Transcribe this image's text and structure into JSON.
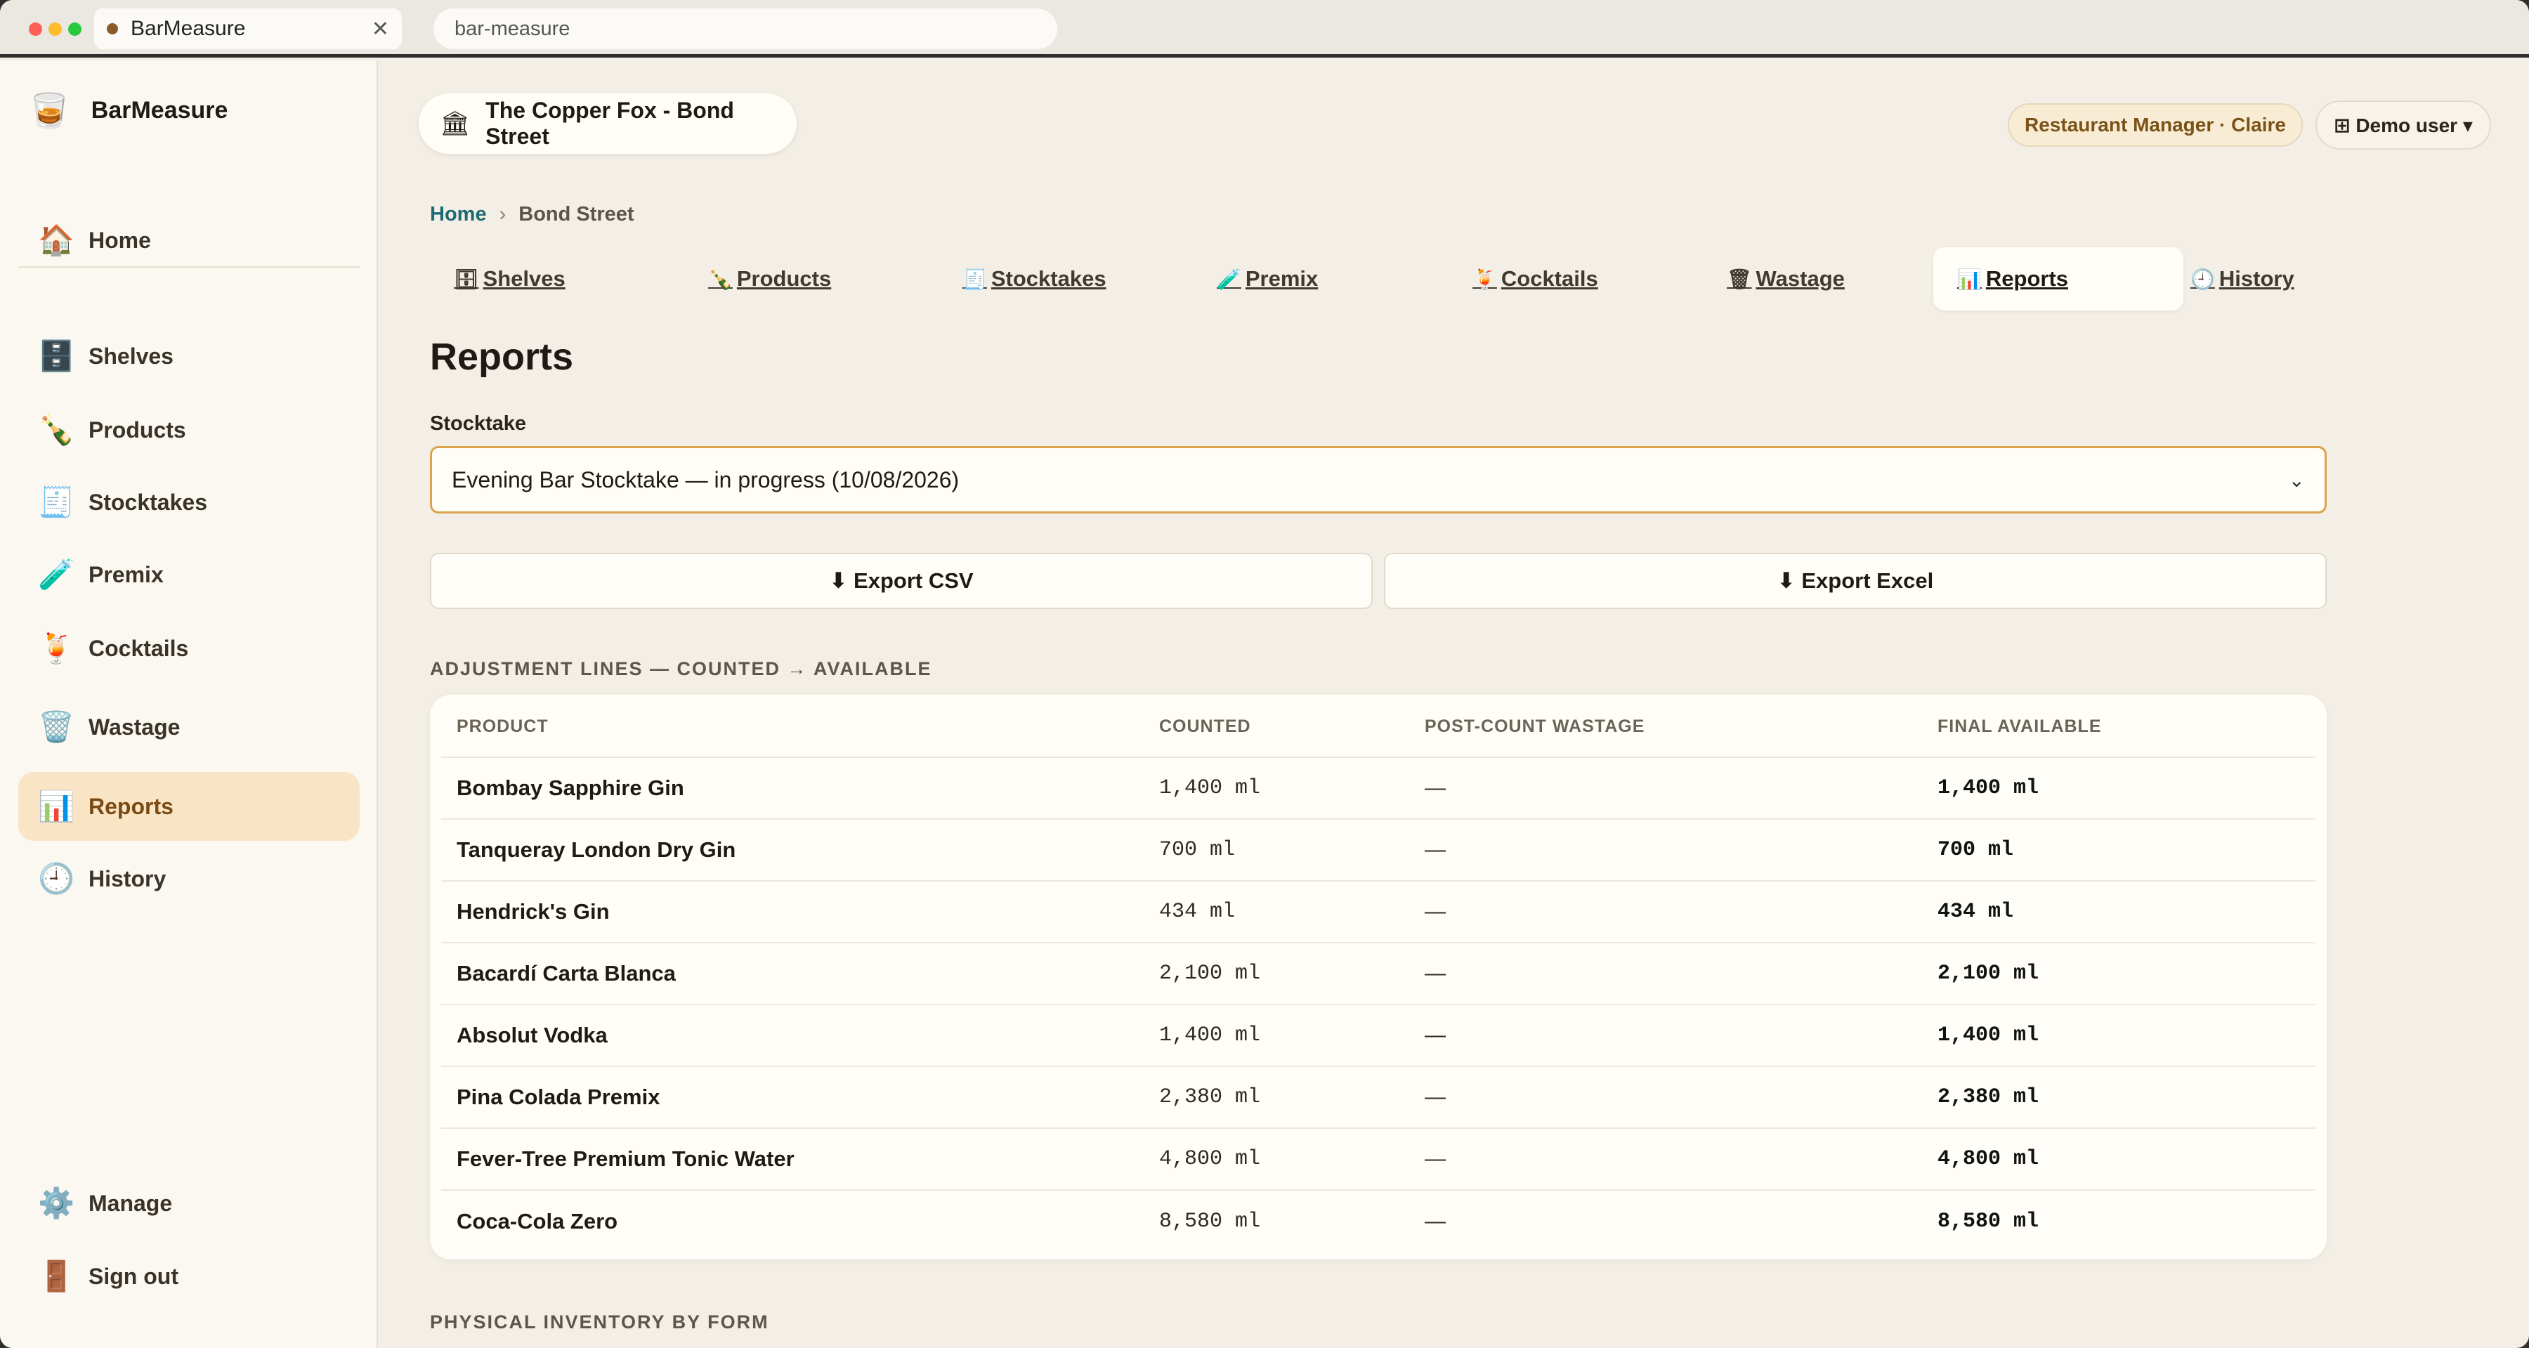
{
  "browser": {
    "tab_title": "BarMeasure",
    "url": "bar-measure"
  },
  "sidebar": {
    "brand": "BarMeasure",
    "items": [
      {
        "label": "Home",
        "icon": "house-icon",
        "glyph": "🏠"
      },
      {
        "label": "Shelves",
        "icon": "cabinet-icon",
        "glyph": "🗄️"
      },
      {
        "label": "Products",
        "icon": "bottle-icon",
        "glyph": "🍾"
      },
      {
        "label": "Stocktakes",
        "icon": "receipt-icon",
        "glyph": "🧾"
      },
      {
        "label": "Premix",
        "icon": "test-tube-icon",
        "glyph": "🧪"
      },
      {
        "label": "Cocktails",
        "icon": "cocktail-icon",
        "glyph": "🍹"
      },
      {
        "label": "Wastage",
        "icon": "wastebasket-icon",
        "glyph": "🗑️"
      },
      {
        "label": "Reports",
        "icon": "bar-chart-icon",
        "glyph": "📊"
      },
      {
        "label": "History",
        "icon": "clock-icon",
        "glyph": "🕘"
      },
      {
        "label": "Manage",
        "icon": "gear-icon",
        "glyph": "⚙️"
      },
      {
        "label": "Sign out",
        "icon": "door-icon",
        "glyph": "🚪"
      }
    ]
  },
  "header": {
    "venue": "The Copper Fox - Bond Street",
    "role": "Restaurant Manager · Claire",
    "user_menu": "⊞ Demo user ▾"
  },
  "breadcrumb": {
    "home": "Home",
    "current": "Bond Street"
  },
  "subnav": [
    {
      "label": "Shelves",
      "glyph": "🗄"
    },
    {
      "label": "Products",
      "glyph": "🍾"
    },
    {
      "label": "Stocktakes",
      "glyph": "🧾"
    },
    {
      "label": "Premix",
      "glyph": "🧪"
    },
    {
      "label": "Cocktails",
      "glyph": "🍹"
    },
    {
      "label": "Wastage",
      "glyph": "🗑"
    },
    {
      "label": "Reports",
      "glyph": "📊"
    },
    {
      "label": "History",
      "glyph": "🕘"
    }
  ],
  "page": {
    "title": "Reports",
    "stocktake_label": "Stocktake",
    "stocktake_value": "Evening Bar Stocktake — in progress (10/08/2026)",
    "export_csv": "⬇ Export CSV",
    "export_excel": "⬇ Export Excel",
    "adjustment_title": "ADJUSTMENT LINES — COUNTED → AVAILABLE",
    "inventory_title": "PHYSICAL INVENTORY BY FORM"
  },
  "table": {
    "headers": [
      "PRODUCT",
      "COUNTED",
      "POST-COUNT WASTAGE",
      "FINAL AVAILABLE"
    ],
    "rows": [
      {
        "product": "Bombay Sapphire Gin",
        "counted": "1,400 ml",
        "wastage": "—",
        "available": "1,400 ml"
      },
      {
        "product": "Tanqueray London Dry Gin",
        "counted": "700 ml",
        "wastage": "—",
        "available": "700 ml"
      },
      {
        "product": "Hendrick's Gin",
        "counted": "434 ml",
        "wastage": "—",
        "available": "434 ml"
      },
      {
        "product": "Bacardí Carta Blanca",
        "counted": "2,100 ml",
        "wastage": "—",
        "available": "2,100 ml"
      },
      {
        "product": "Absolut Vodka",
        "counted": "1,400 ml",
        "wastage": "—",
        "available": "1,400 ml"
      },
      {
        "product": "Pina Colada Premix",
        "counted": "2,380 ml",
        "wastage": "—",
        "available": "2,380 ml"
      },
      {
        "product": "Fever-Tree Premium Tonic Water",
        "counted": "4,800 ml",
        "wastage": "—",
        "available": "4,800 ml"
      },
      {
        "product": "Coca-Cola Zero",
        "counted": "8,580 ml",
        "wastage": "—",
        "available": "8,580 ml"
      }
    ]
  }
}
